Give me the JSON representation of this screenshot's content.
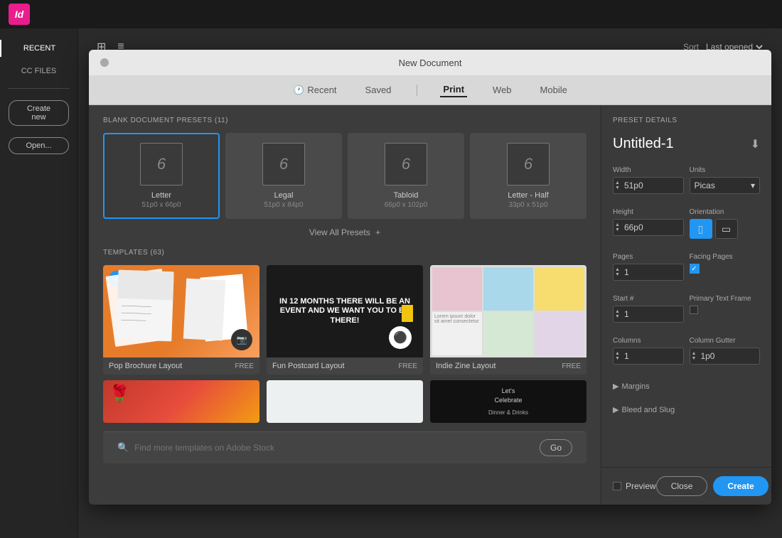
{
  "app": {
    "title": "Adobe InDesign",
    "icon_label": "Id"
  },
  "toolbar": {
    "sort_label": "Sort",
    "sort_value": "Last opened",
    "view_grid_icon": "grid-icon",
    "view_list_icon": "list-icon"
  },
  "sidebar": {
    "recent_label": "RECENT",
    "cc_files_label": "CC FILES",
    "create_new_label": "Create new",
    "open_label": "Open..."
  },
  "modal": {
    "title": "New Document",
    "traffic_light_1": "",
    "tabs": [
      {
        "label": "Recent",
        "icon": "clock"
      },
      {
        "label": "Saved"
      },
      {
        "label": "Print",
        "active": true
      },
      {
        "label": "Web"
      },
      {
        "label": "Mobile"
      }
    ],
    "blank_presets_section": "BLANK DOCUMENT PRESETS",
    "blank_presets_count": "(11)",
    "presets": [
      {
        "name": "Letter",
        "size": "51p0 x 66p0",
        "selected": true
      },
      {
        "name": "Legal",
        "size": "51p0 x 84p0"
      },
      {
        "name": "Tabloid",
        "size": "66p0 x 102p0"
      },
      {
        "name": "Letter - Half",
        "size": "33p0 x 51p0"
      }
    ],
    "view_all_label": "View All Presets",
    "templates_section": "TEMPLATES",
    "templates_count": "(63)",
    "templates": [
      {
        "name": "Pop Brochure Layout",
        "badge": "FREE",
        "selected": true
      },
      {
        "name": "Fun Postcard Layout",
        "badge": "FREE"
      },
      {
        "name": "Indie Zine Layout",
        "badge": "FREE"
      }
    ],
    "search_placeholder": "Find more templates on Adobe Stock",
    "go_label": "Go"
  },
  "preset_details": {
    "section_label": "PRESET DETAILS",
    "doc_name": "Untitled-1",
    "width_label": "Width",
    "width_value": "51p0",
    "height_label": "Height",
    "height_value": "66p0",
    "units_label": "Units",
    "units_value": "Picas",
    "orientation_label": "Orientation",
    "pages_label": "Pages",
    "pages_value": "1",
    "facing_pages_label": "Facing Pages",
    "start_label": "Start #",
    "start_value": "1",
    "primary_text_label": "Primary Text Frame",
    "columns_label": "Columns",
    "columns_value": "1",
    "column_gutter_label": "Column Gutter",
    "column_gutter_value": "1p0",
    "margins_label": "Margins",
    "bleed_slug_label": "Bleed and Slug"
  },
  "footer": {
    "preview_label": "Preview",
    "close_label": "Close",
    "create_label": "Create"
  },
  "fun_postcard_text": "in 12 months there will be an event and we want you to be there!",
  "dinner_text": "Dinner & Drinks"
}
